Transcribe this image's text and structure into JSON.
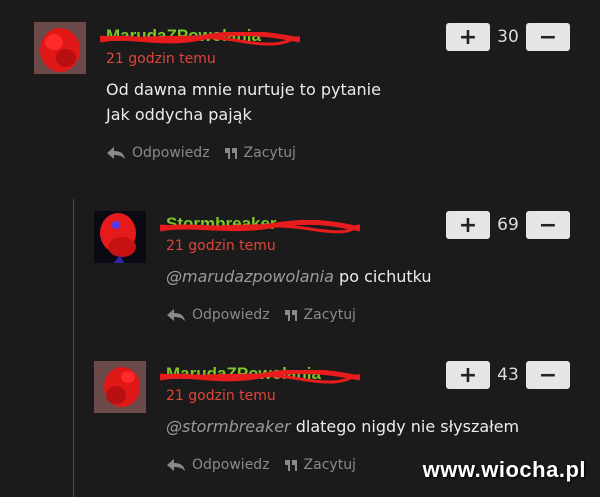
{
  "comments": [
    {
      "username": "MarudaZPowolania",
      "time": "21 godzin temu",
      "lines": [
        "Od dawna mnie nurtuje to pytanie",
        "Jak oddycha pająk"
      ],
      "mention": "",
      "text": "",
      "score": "30",
      "reply_label": "Odpowiedz",
      "quote_label": "Zacytuj"
    },
    {
      "username": "Stormbreaker",
      "time": "21 godzin temu",
      "lines": [],
      "mention": "@marudazpowolania",
      "text": "po cichutku",
      "score": "69",
      "reply_label": "Odpowiedz",
      "quote_label": "Zacytuj"
    },
    {
      "username": "MarudaZPowolania",
      "time": "21 godzin temu",
      "lines": [],
      "mention": "@stormbreaker",
      "text": "dlatego nigdy nie słyszałem",
      "score": "43",
      "reply_label": "Odpowiedz",
      "quote_label": "Zacytuj"
    }
  ],
  "vote": {
    "plus": "+",
    "minus": "−"
  },
  "watermark": "www.wiocha.pl",
  "colors": {
    "username": "#7cc52c",
    "time": "#e0453a",
    "background": "#1b1b1b"
  }
}
